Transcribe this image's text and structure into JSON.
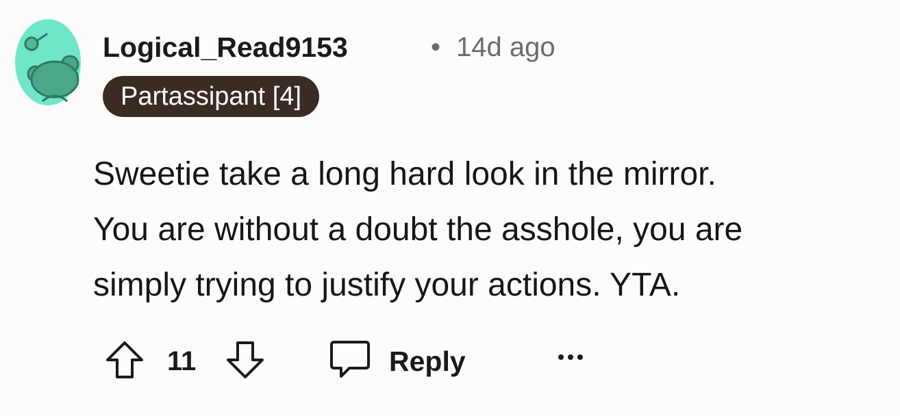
{
  "comment": {
    "author": "Logical_Read9153",
    "separator": "•",
    "age": "14d ago",
    "flair": "Partassipant [4]",
    "body_lines": [
      "Sweetie take a long hard look in the mirror.",
      "You are without a doubt the asshole, you are",
      "simply trying to justify your actions. YTA."
    ]
  },
  "actions": {
    "upvote_icon": "arrow-up-icon",
    "vote_count": "11",
    "downvote_icon": "arrow-down-icon",
    "reply_icon": "speech-bubble-icon",
    "reply_label": "Reply",
    "more_icon": "ellipsis-icon"
  },
  "colors": {
    "background": "#fcfcfb",
    "flair_bg": "#3a2c25",
    "flair_text": "#ffffff",
    "avatar_bg": "#6ee7c8",
    "muted_text": "#6b6b6b"
  }
}
